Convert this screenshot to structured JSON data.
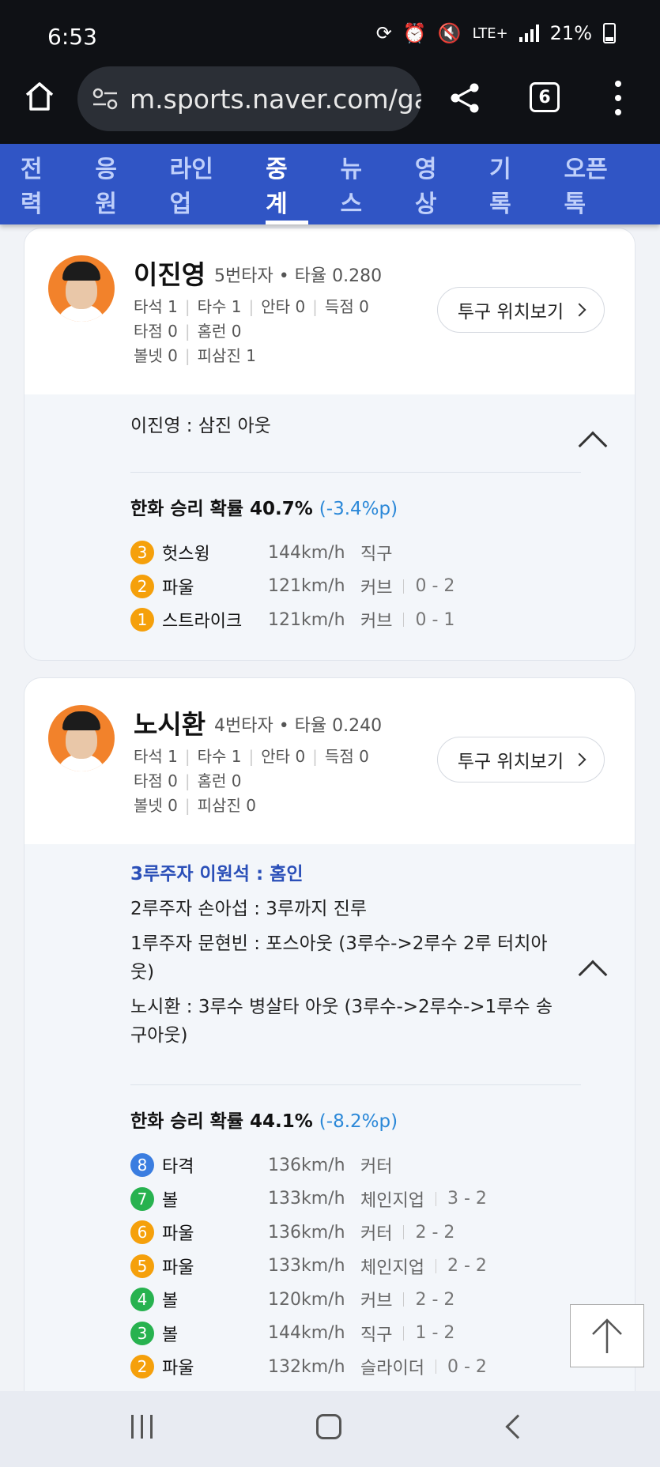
{
  "status_bar": {
    "time": "6:53",
    "network": "LTE+",
    "battery": "21%"
  },
  "browser": {
    "url": "m.sports.naver.com/gai",
    "tab_count": "6"
  },
  "nav": {
    "items": [
      "전력",
      "응원",
      "라인업",
      "중계",
      "뉴스",
      "영상",
      "기록",
      "오픈톡"
    ],
    "active": "중계"
  },
  "cards": [
    {
      "player": "이진영",
      "order": "5번타자",
      "avg": "• 타율 0.280",
      "stats_row1": [
        "타석 1",
        "타수 1",
        "안타 0",
        "득점 0"
      ],
      "stats_row2": [
        "타점 0",
        "홈런 0"
      ],
      "stats_row3": [
        "볼넷 0",
        "피삼진 1"
      ],
      "pitch_button": "투구 위치보기",
      "results": [
        "이진영 : 삼진 아웃"
      ],
      "prob_label": "한화 승리 확률 40.7%",
      "prob_delta": "(-3.4%p)",
      "pitches": [
        {
          "n": "3",
          "color": "#f5a00b",
          "result": "헛스윙",
          "speed": "144km/h",
          "type": "직구",
          "count": ""
        },
        {
          "n": "2",
          "color": "#f5a00b",
          "result": "파울",
          "speed": "121km/h",
          "type": "커브",
          "count": "0 - 2"
        },
        {
          "n": "1",
          "color": "#f5a00b",
          "result": "스트라이크",
          "speed": "121km/h",
          "type": "커브",
          "count": "0 - 1"
        }
      ]
    },
    {
      "player": "노시환",
      "order": "4번타자",
      "avg": "• 타율 0.240",
      "stats_row1": [
        "타석 1",
        "타수 1",
        "안타 0",
        "득점 0"
      ],
      "stats_row2": [
        "타점 0",
        "홈런 0"
      ],
      "stats_row3": [
        "볼넷 0",
        "피삼진 0"
      ],
      "pitch_button": "투구 위치보기",
      "results": [
        "3루주자 이원석 : 홈인",
        "2루주자 손아섭 : 3루까지 진루",
        "1루주자 문현빈 : 포스아웃 (3루수->2루수 2루 터치아웃)",
        "노시환 : 3루수 병살타 아웃 (3루수->2루수->1루수 송구아웃)"
      ],
      "prob_label": "한화 승리 확률 44.1%",
      "prob_delta": "(-8.2%p)",
      "pitches": [
        {
          "n": "8",
          "color": "#3a7de0",
          "result": "타격",
          "speed": "136km/h",
          "type": "커터",
          "count": ""
        },
        {
          "n": "7",
          "color": "#27b24f",
          "result": "볼",
          "speed": "133km/h",
          "type": "체인지업",
          "count": "3 - 2"
        },
        {
          "n": "6",
          "color": "#f5a00b",
          "result": "파울",
          "speed": "136km/h",
          "type": "커터",
          "count": "2 - 2"
        },
        {
          "n": "5",
          "color": "#f5a00b",
          "result": "파울",
          "speed": "133km/h",
          "type": "체인지업",
          "count": "2 - 2"
        },
        {
          "n": "4",
          "color": "#27b24f",
          "result": "볼",
          "speed": "120km/h",
          "type": "커브",
          "count": "2 - 2"
        },
        {
          "n": "3",
          "color": "#27b24f",
          "result": "볼",
          "speed": "144km/h",
          "type": "직구",
          "count": "1 - 2"
        },
        {
          "n": "2",
          "color": "#f5a00b",
          "result": "파울",
          "speed": "132km/h",
          "type": "슬라이더",
          "count": "0 - 2"
        }
      ]
    }
  ]
}
